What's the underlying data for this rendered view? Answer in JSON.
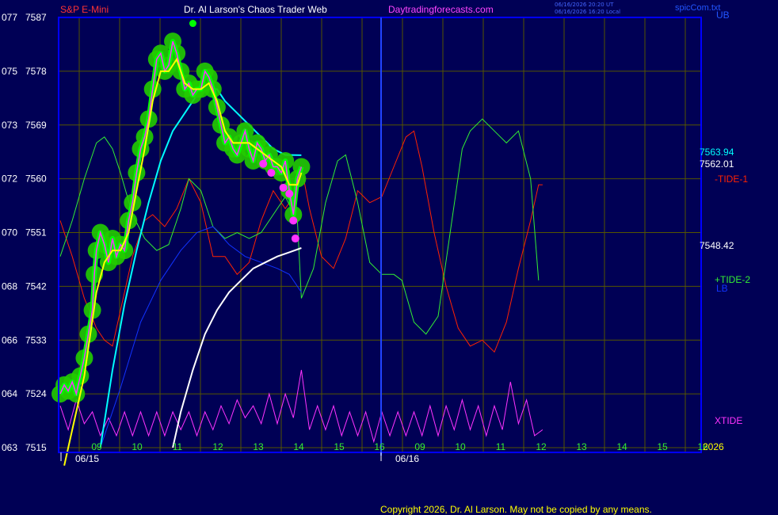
{
  "header": {
    "left_title": "S&P E-Mini",
    "center_title": "Dr. Al Larson's Chaos Trader Web",
    "site": "Daytradingforecasts.com",
    "stamp_ut": "06/16/2026 20:20 UT",
    "stamp_local": "06/16/2026 16:20 Local",
    "corner": "spicCom.txt",
    "corner_ub": "UB"
  },
  "footer": {
    "copyright": "Copyright 2026, Dr. Al Larson. May not be copied by any means."
  },
  "colors": {
    "background": "#000055",
    "frame": "#0000ff",
    "grid": "#555500",
    "price": "#00ff00",
    "glow": "#22cc00",
    "average": "#ffff00",
    "avg_short": "#00ffff",
    "avg_long": "#ffffff",
    "band": "#1133ff",
    "tide1": "#ff2200",
    "tide2": "#33ee33",
    "xtide": "#ff33ff"
  },
  "chart_data": {
    "type": "line",
    "ylim": [
      7515,
      7587
    ],
    "y_ticks": [
      {
        "left": "077",
        "right": "7587",
        "v": 7587
      },
      {
        "left": "075",
        "right": "7578",
        "v": 7578
      },
      {
        "left": "073",
        "right": "7569",
        "v": 7569
      },
      {
        "left": "072",
        "right": "7560",
        "v": 7560
      },
      {
        "left": "070",
        "right": "7551",
        "v": 7551
      },
      {
        "left": "068",
        "right": "7542",
        "v": 7542
      },
      {
        "left": "066",
        "right": "7533",
        "v": 7533
      },
      {
        "left": "064",
        "right": "7524",
        "v": 7524
      },
      {
        "left": "063",
        "right": "7515",
        "v": 7515
      }
    ],
    "x_ticks": [
      {
        "label": "09",
        "t": 0.5
      },
      {
        "label": "10",
        "t": 1.5
      },
      {
        "label": "11",
        "t": 2.5
      },
      {
        "label": "12",
        "t": 3.5
      },
      {
        "label": "13",
        "t": 4.5
      },
      {
        "label": "14",
        "t": 5.5
      },
      {
        "label": "15",
        "t": 6.5
      },
      {
        "label": "16",
        "t": 7.5
      },
      {
        "label": "09",
        "t": 8.5
      },
      {
        "label": "10",
        "t": 9.5
      },
      {
        "label": "11",
        "t": 10.5
      },
      {
        "label": "12",
        "t": 11.5
      },
      {
        "label": "13",
        "t": 12.5
      },
      {
        "label": "14",
        "t": 13.5
      },
      {
        "label": "15",
        "t": 14.5
      },
      {
        "label": "16",
        "t": 15.5
      }
    ],
    "dates": [
      {
        "label": "06/15",
        "t": 0.8
      },
      {
        "label": "06/16",
        "t": 8.7
      }
    ],
    "year": "2026",
    "price_series": {
      "name": "S&P E-Mini",
      "points": [
        [
          0,
          7524
        ],
        [
          0.1,
          7525.5
        ],
        [
          0.2,
          7524.5
        ],
        [
          0.3,
          7526
        ],
        [
          0.4,
          7524
        ],
        [
          0.5,
          7527
        ],
        [
          0.6,
          7530
        ],
        [
          0.7,
          7534
        ],
        [
          0.8,
          7538
        ],
        [
          0.85,
          7544
        ],
        [
          0.9,
          7548
        ],
        [
          1.0,
          7551
        ],
        [
          1.1,
          7549
        ],
        [
          1.2,
          7546
        ],
        [
          1.3,
          7550
        ],
        [
          1.4,
          7547
        ],
        [
          1.5,
          7549
        ],
        [
          1.6,
          7548
        ],
        [
          1.7,
          7553
        ],
        [
          1.8,
          7556
        ],
        [
          1.9,
          7561
        ],
        [
          2.0,
          7565
        ],
        [
          2.1,
          7567
        ],
        [
          2.2,
          7570
        ],
        [
          2.3,
          7575
        ],
        [
          2.4,
          7580
        ],
        [
          2.5,
          7581
        ],
        [
          2.6,
          7578
        ],
        [
          2.7,
          7579
        ],
        [
          2.8,
          7583
        ],
        [
          2.9,
          7581
        ],
        [
          3.0,
          7578
        ],
        [
          3.1,
          7575
        ],
        [
          3.2,
          7576
        ],
        [
          3.3,
          7574
        ],
        [
          3.4,
          7575
        ],
        [
          3.5,
          7575
        ],
        [
          3.6,
          7578
        ],
        [
          3.7,
          7577
        ],
        [
          3.8,
          7575
        ],
        [
          3.9,
          7572
        ],
        [
          4.0,
          7569
        ],
        [
          4.1,
          7566
        ],
        [
          4.2,
          7567
        ],
        [
          4.3,
          7565
        ],
        [
          4.4,
          7564
        ],
        [
          4.5,
          7566
        ],
        [
          4.6,
          7568
        ],
        [
          4.7,
          7565
        ],
        [
          4.8,
          7563
        ],
        [
          4.9,
          7566
        ],
        [
          5.0,
          7565
        ],
        [
          5.1,
          7563
        ],
        [
          5.2,
          7564
        ],
        [
          5.3,
          7562
        ],
        [
          5.4,
          7562
        ],
        [
          5.5,
          7561
        ],
        [
          5.6,
          7563
        ],
        [
          5.7,
          7558
        ],
        [
          5.8,
          7554
        ],
        [
          5.9,
          7560
        ],
        [
          6.0,
          7562
        ]
      ]
    },
    "band_series": {
      "name": "Yellow average",
      "points": [
        [
          0.1,
          7512
        ],
        [
          0.3,
          7518
        ],
        [
          0.6,
          7527
        ],
        [
          0.9,
          7541
        ],
        [
          1.1,
          7546
        ],
        [
          1.3,
          7548
        ],
        [
          1.5,
          7548
        ],
        [
          1.7,
          7551
        ],
        [
          1.9,
          7558
        ],
        [
          2.1,
          7565
        ],
        [
          2.3,
          7573
        ],
        [
          2.5,
          7578
        ],
        [
          2.7,
          7578
        ],
        [
          2.9,
          7580
        ],
        [
          3.1,
          7576
        ],
        [
          3.3,
          7575
        ],
        [
          3.5,
          7575
        ],
        [
          3.7,
          7576
        ],
        [
          3.9,
          7573
        ],
        [
          4.1,
          7568
        ],
        [
          4.3,
          7566
        ],
        [
          4.5,
          7566
        ],
        [
          4.7,
          7566
        ],
        [
          4.9,
          7565
        ],
        [
          5.1,
          7564
        ],
        [
          5.3,
          7563
        ],
        [
          5.5,
          7562
        ],
        [
          5.7,
          7559
        ],
        [
          5.9,
          7559
        ],
        [
          6.0,
          7561
        ]
      ]
    },
    "avg_short_series": {
      "name": "Short average",
      "points": [
        [
          1.0,
          7515
        ],
        [
          1.3,
          7528
        ],
        [
          1.6,
          7539
        ],
        [
          1.9,
          7548
        ],
        [
          2.2,
          7556
        ],
        [
          2.5,
          7563
        ],
        [
          2.8,
          7568
        ],
        [
          3.1,
          7571
        ],
        [
          3.4,
          7574
        ],
        [
          3.7,
          7575
        ],
        [
          3.9,
          7575
        ],
        [
          4.1,
          7573
        ],
        [
          4.4,
          7571
        ],
        [
          4.7,
          7569
        ],
        [
          5.0,
          7567
        ],
        [
          5.3,
          7565
        ],
        [
          5.6,
          7564
        ],
        [
          6.0,
          7563.94
        ]
      ]
    },
    "avg_long_series": {
      "name": "Long average",
      "points": [
        [
          2.8,
          7515
        ],
        [
          3.0,
          7521
        ],
        [
          3.3,
          7528
        ],
        [
          3.6,
          7534
        ],
        [
          3.9,
          7538
        ],
        [
          4.2,
          7541
        ],
        [
          4.5,
          7543
        ],
        [
          4.8,
          7545
        ],
        [
          5.1,
          7546
        ],
        [
          5.4,
          7547
        ],
        [
          5.7,
          7547.7
        ],
        [
          6.0,
          7548.42
        ]
      ]
    },
    "band_lines": [
      {
        "name": "LB",
        "points": [
          [
            1.0,
            7515
          ],
          [
            1.5,
            7525
          ],
          [
            2.0,
            7536
          ],
          [
            2.5,
            7543
          ],
          [
            3.0,
            7548
          ],
          [
            3.4,
            7551
          ],
          [
            3.8,
            7552
          ],
          [
            4.2,
            7549
          ],
          [
            4.6,
            7547
          ],
          [
            5.0,
            7546
          ],
          [
            5.4,
            7545
          ],
          [
            5.7,
            7544
          ],
          [
            6.0,
            7541
          ]
        ]
      }
    ],
    "tide1": {
      "name": "-TIDE-1",
      "points": [
        [
          0,
          7553
        ],
        [
          0.3,
          7547
        ],
        [
          0.6,
          7540
        ],
        [
          0.9,
          7535
        ],
        [
          1.1,
          7533
        ],
        [
          1.3,
          7532
        ],
        [
          1.5,
          7538
        ],
        [
          1.8,
          7547
        ],
        [
          2.1,
          7553
        ],
        [
          2.3,
          7554
        ],
        [
          2.6,
          7552
        ],
        [
          2.9,
          7555
        ],
        [
          3.2,
          7560
        ],
        [
          3.5,
          7556
        ],
        [
          3.8,
          7547
        ],
        [
          4.1,
          7547
        ],
        [
          4.4,
          7544
        ],
        [
          4.7,
          7546
        ],
        [
          5.0,
          7553
        ],
        [
          5.3,
          7558
        ],
        [
          5.6,
          7555
        ],
        [
          5.8,
          7557
        ],
        [
          6.0,
          7562
        ],
        [
          6.2,
          7555
        ],
        [
          6.5,
          7547
        ],
        [
          6.8,
          7545
        ],
        [
          7.1,
          7550
        ],
        [
          7.4,
          7558
        ],
        [
          7.7,
          7556
        ],
        [
          8.0,
          7557
        ],
        [
          8.3,
          7562
        ],
        [
          8.6,
          7567
        ],
        [
          8.8,
          7568
        ],
        [
          9.0,
          7562
        ],
        [
          9.3,
          7551
        ],
        [
          9.6,
          7542
        ],
        [
          9.9,
          7535
        ],
        [
          10.2,
          7532
        ],
        [
          10.5,
          7533
        ],
        [
          10.8,
          7531
        ],
        [
          11.1,
          7536
        ],
        [
          11.4,
          7545
        ],
        [
          11.7,
          7553
        ],
        [
          11.9,
          7559
        ],
        [
          12.0,
          7559
        ]
      ]
    },
    "tide2": {
      "name": "+TIDE-2",
      "points": [
        [
          0,
          7547
        ],
        [
          0.3,
          7553
        ],
        [
          0.6,
          7560
        ],
        [
          0.9,
          7566
        ],
        [
          1.1,
          7567
        ],
        [
          1.3,
          7565
        ],
        [
          1.5,
          7561
        ],
        [
          1.8,
          7554
        ],
        [
          2.1,
          7550
        ],
        [
          2.4,
          7548
        ],
        [
          2.7,
          7549
        ],
        [
          3.0,
          7555
        ],
        [
          3.2,
          7560
        ],
        [
          3.5,
          7558
        ],
        [
          3.8,
          7552
        ],
        [
          4.1,
          7550
        ],
        [
          4.4,
          7551
        ],
        [
          4.7,
          7550
        ],
        [
          5.0,
          7551
        ],
        [
          5.3,
          7554
        ],
        [
          5.6,
          7557
        ],
        [
          5.9,
          7553
        ],
        [
          6.0,
          7540
        ],
        [
          6.3,
          7545
        ],
        [
          6.6,
          7556
        ],
        [
          6.9,
          7563
        ],
        [
          7.1,
          7564
        ],
        [
          7.4,
          7556
        ],
        [
          7.7,
          7546
        ],
        [
          8.0,
          7544
        ],
        [
          8.3,
          7544
        ],
        [
          8.5,
          7543
        ],
        [
          8.8,
          7536
        ],
        [
          9.1,
          7534
        ],
        [
          9.4,
          7537
        ],
        [
          9.7,
          7551
        ],
        [
          10.0,
          7565
        ],
        [
          10.2,
          7568
        ],
        [
          10.5,
          7570
        ],
        [
          10.8,
          7568
        ],
        [
          11.1,
          7566
        ],
        [
          11.4,
          7568
        ],
        [
          11.7,
          7560
        ],
        [
          11.9,
          7543
        ]
      ]
    },
    "xtide": {
      "name": "XTIDE",
      "cycles": 28,
      "points": [
        [
          0,
          7522
        ],
        [
          0.2,
          7518
        ],
        [
          0.4,
          7523
        ],
        [
          0.6,
          7519
        ],
        [
          0.8,
          7521
        ],
        [
          1.0,
          7517
        ],
        [
          1.2,
          7520
        ],
        [
          1.4,
          7517
        ],
        [
          1.6,
          7521
        ],
        [
          1.8,
          7517
        ],
        [
          2.0,
          7521
        ],
        [
          2.2,
          7517
        ],
        [
          2.4,
          7521
        ],
        [
          2.6,
          7517
        ],
        [
          2.8,
          7521
        ],
        [
          3.0,
          7518
        ],
        [
          3.2,
          7521
        ],
        [
          3.4,
          7517
        ],
        [
          3.6,
          7521
        ],
        [
          3.8,
          7518
        ],
        [
          4.0,
          7522
        ],
        [
          4.2,
          7519
        ],
        [
          4.4,
          7523
        ],
        [
          4.6,
          7520
        ],
        [
          4.8,
          7522
        ],
        [
          5.0,
          7519
        ],
        [
          5.2,
          7524
        ],
        [
          5.4,
          7519
        ],
        [
          5.6,
          7524
        ],
        [
          5.8,
          7520
        ],
        [
          6.0,
          7528
        ],
        [
          6.2,
          7518
        ],
        [
          6.4,
          7522
        ],
        [
          6.6,
          7518
        ],
        [
          6.8,
          7522
        ],
        [
          7.0,
          7517
        ],
        [
          7.2,
          7521
        ],
        [
          7.4,
          7517
        ],
        [
          7.6,
          7521
        ],
        [
          7.8,
          7516
        ],
        [
          8.0,
          7521
        ],
        [
          8.2,
          7517
        ],
        [
          8.4,
          7521
        ],
        [
          8.6,
          7517
        ],
        [
          8.8,
          7521
        ],
        [
          9.0,
          7517
        ],
        [
          9.2,
          7522
        ],
        [
          9.4,
          7517
        ],
        [
          9.6,
          7522
        ],
        [
          9.8,
          7518
        ],
        [
          10.0,
          7523
        ],
        [
          10.2,
          7518
        ],
        [
          10.4,
          7522
        ],
        [
          10.6,
          7517
        ],
        [
          10.8,
          7522
        ],
        [
          11.0,
          7518
        ],
        [
          11.2,
          7526
        ],
        [
          11.4,
          7519
        ],
        [
          11.6,
          7523
        ],
        [
          11.8,
          7517
        ],
        [
          12.0,
          7518
        ]
      ]
    },
    "pivot_marks": [
      [
        5.05,
        7562.5
      ],
      [
        5.25,
        7561
      ],
      [
        5.55,
        7558.5
      ],
      [
        5.7,
        7557.5
      ],
      [
        5.8,
        7553
      ],
      [
        5.85,
        7550
      ]
    ],
    "peak_mark": [
      3.3,
      7586
    ],
    "labels": {
      "val_short": "7563.94",
      "val_price": "7562.01",
      "tide1_label": "-TIDE-1",
      "val_long": "7548.42",
      "tide2_label": "+TIDE-2",
      "lb_label": "LB",
      "xtide_label": "XTIDE"
    }
  }
}
